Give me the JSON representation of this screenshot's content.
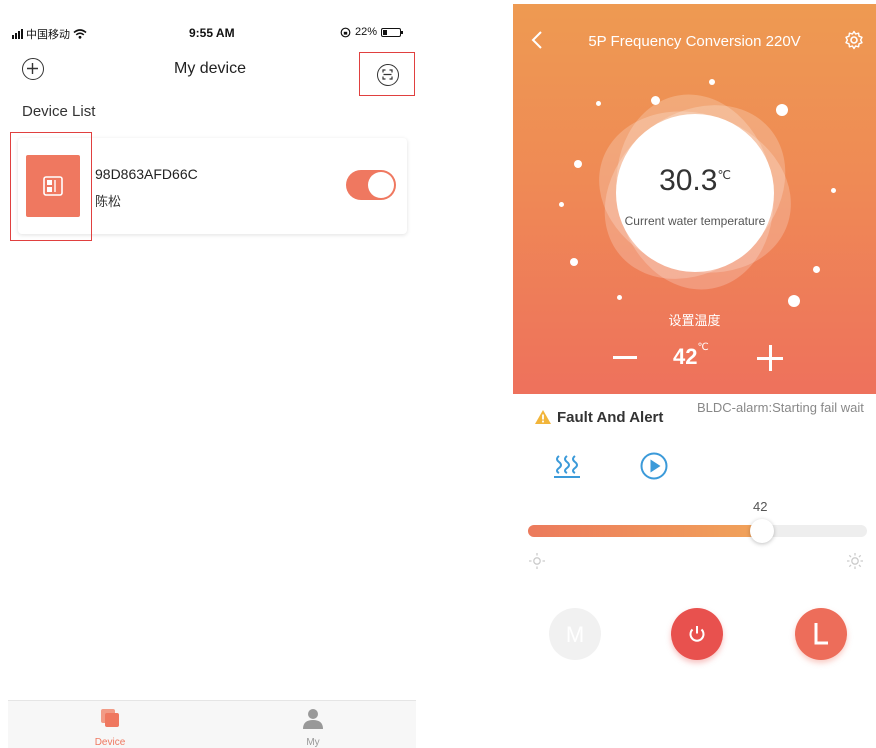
{
  "status_bar": {
    "carrier": "中国移动",
    "time": "9:55 AM",
    "battery": "22%"
  },
  "left_screen": {
    "title": "My device",
    "section_title": "Device List",
    "device": {
      "id": "98D863AFD66C",
      "owner": "陈松",
      "power_on": true
    },
    "tabs": [
      {
        "label": "Device",
        "active": true,
        "icon": "device-tab-icon"
      },
      {
        "label": "My",
        "active": false,
        "icon": "person-icon"
      }
    ],
    "highlight_color": "#e0403f"
  },
  "right_screen": {
    "title": "5P Frequency Conversion 220V",
    "current_temp": "30.3",
    "temp_unit": "℃",
    "current_temp_label": "Current water temperature",
    "set_temp_label": "设置温度",
    "set_temp": "42",
    "alert_title": "Fault And Alert",
    "alert_message": "BLDC-alarm:Starting fail wait",
    "slider": {
      "value": "42",
      "fraction": 0.69
    },
    "buttons": {
      "mode": "M"
    },
    "colors": {
      "accent": "#ef7860",
      "power": "#e8514e",
      "icon_blue": "#3b9ad9"
    }
  }
}
